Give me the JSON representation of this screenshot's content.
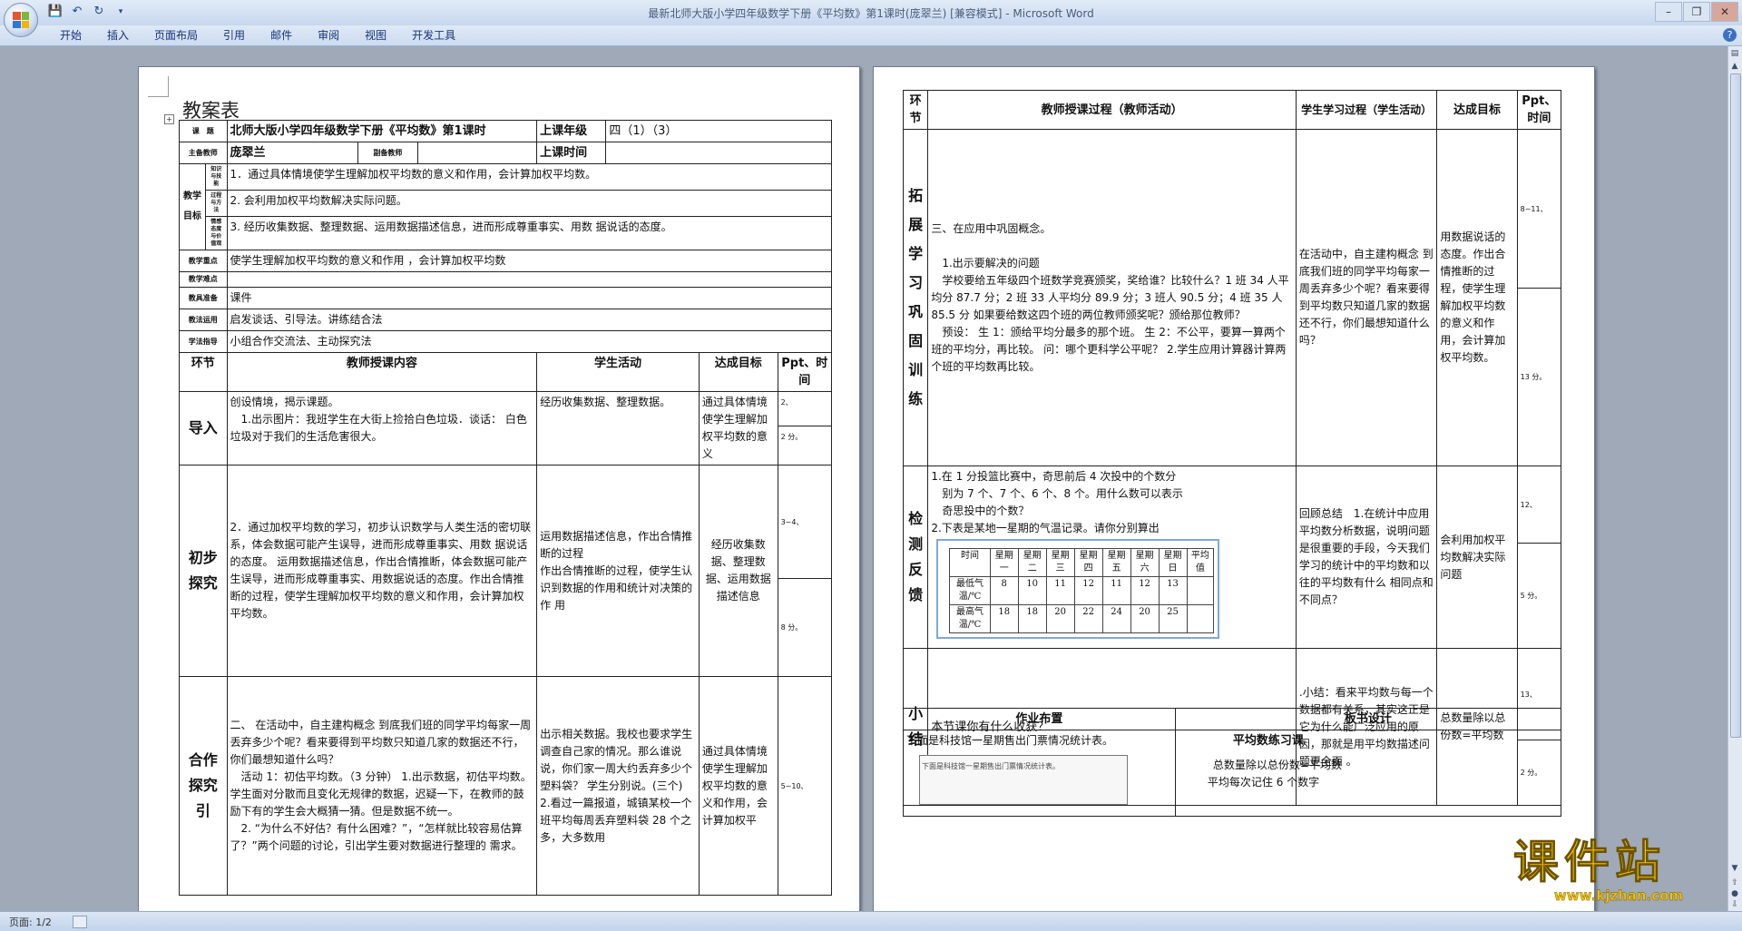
{
  "window": {
    "title": "最新北师大版小学四年级数学下册《平均数》第1课时(庞翠兰) [兼容模式] - Microsoft Word"
  },
  "ribbon": {
    "tabs": [
      "开始",
      "插入",
      "页面布局",
      "引用",
      "邮件",
      "审阅",
      "视图",
      "开发工具"
    ]
  },
  "page1": {
    "title": "教案表",
    "info": {
      "lesson_label": "课　题",
      "lesson": "北师大版小学四年级数学下册《平均数》第1课时",
      "grade_label": "上课年级",
      "grade": "四（1）（3）",
      "main_teacher_label": "主备教师",
      "main_teacher": "庞翠兰",
      "vice_teacher_label": "副备教师",
      "time_label": "上课时间"
    },
    "goals_label": "教学目标",
    "goal_sub_labels": [
      "知识与技能",
      "过程与方法",
      "情感态度与价值观"
    ],
    "goals": [
      "1．通过具体情境使学生理解加权平均数的意义和作用，会计算加权平均数。",
      "2. 会利用加权平均数解决实际问题。",
      "3. 经历收集数据、整理数据、运用数据描述信息，进而形成尊重事实、用数 据说话的态度。"
    ],
    "rows": [
      {
        "label": "教学重点",
        "text": "使学生理解加权平均数的意义和作用 ，会计算加权平均数"
      },
      {
        "label": "教学难点",
        "text": ""
      },
      {
        "label": "教具准备",
        "text": "课件"
      },
      {
        "label": "教法运用",
        "text": "启发谈话、引导法。讲练结合法"
      },
      {
        "label": "学法指导",
        "text": "小组合作交流法、主动探究法"
      }
    ],
    "header": {
      "section": "环节",
      "teacher": "教师授课内容",
      "student": "学生活动",
      "goal": "达成目标",
      "time": "Ppt、时间"
    },
    "stages": [
      {
        "name": "导入",
        "teacher": "创设情境，揭示课题。\n　1.出示图片：我班学生在大街上捡拾白色垃圾．谈话： 白色垃圾对于我们的生活危害很大。",
        "student": "经历收集数据、整理数据。",
        "goal": "通过具体情境使学生理解加权平均数的意义",
        "ppt": "2、",
        "time": "2 分。"
      },
      {
        "name": "初步探究",
        "teacher": "2．通过加权平均数的学习，初步认识数学与人类生活的密切联系，体会数据可能产生误导，进而形成尊重事实、用数 据说话的态度。 运用数据描述信息，作出合情推断，体会数据可能产生误导，进而形成尊重事实、用数据说话的态度。作出合情推断的过程，使学生理解加权平均数的意义和作用，会计算加权平均数。",
        "student": "运用数据描述信息，作出合情推断的过程\n作出合情推断的过程，使学生认识到数据的作用和统计对决策的作 用",
        "goal": "经历收集数据、整理数据、运用数据描述信息",
        "ppt": "3~4、",
        "time": "8 分。"
      },
      {
        "name": "合作探究引",
        "teacher": "二、 在活动中，自主建构概念 到底我们班的同学平均每家一周丢弃多少个呢？看来要得到平均数只知道几家的数据还不行，你们最想知道什么吗？\n　活动 1：初估平均数。（3 分钟） 1.出示数据，初估平均数。学生面对分散而且变化无规律的数据，迟疑一下，在教师的鼓励下有的学生会大概猜一猜。但是数据不统一。\n　2. “为什么不好估？有什么困难？”，“怎样就比较容易估算了？”两个问题的讨论，引出学生要对数据进行整理的 需求。",
        "student": "出示相关数据。我校也要求学生调查自己家的情况。那么谁说说，你们家一周大约丢弃多少个塑料袋？ 学生分别说。(三个)\n2.看过一篇报道，城镇某校一个班平均每周丢弃塑料袋 28 个之多，大多数用",
        "goal": "通过具体情境使学生理解加权平均数的意义和作用，会计算加权平",
        "ppt": "5~10、",
        "time": ""
      }
    ]
  },
  "page2": {
    "header": {
      "section": "环节",
      "teacher": "教师授课过程（教师活动）",
      "student": "学生学习过程（学生活动）",
      "goal": "达成目标",
      "time": "Ppt、时间"
    },
    "stages": [
      {
        "name": "拓展学习巩固训练",
        "teacher": "三、在应用中巩固概念。\n\n　1.出示要解决的问题\n　学校要给五年级四个班数学竞赛颁奖，奖给谁？比较什么？1 班 34 人平均分 87.7 分；2 班 33 人平均分 89.9 分；3 班人 90.5 分；4 班 35 人 85.5 分 如果要给数这四个班的两位教师颁奖呢？颁给那位教师？\n　预设： 生 1：颁给平均分最多的那个班。 生 2：不公平，要算一算两个班的平均分，再比较。 问：哪个更科学公平呢？ 2.学生应用计算器计算两个班的平均数再比较。",
        "student": "在活动中，自主建构概念 到底我们班的同学平均每家一周丢弃多少个呢？看来要得到平均数只知道几家的数据还不行，你们最想知道什么吗？",
        "goal": "用数据说话的态度。作出合情推断的过程，使学生理解加权平均数的意义和作用，会计算加权平均数。",
        "ppt": "8~11、",
        "time": "13 分。"
      },
      {
        "name": "检测反馈",
        "teacher_lines": [
          "1.在 1 分投篮比赛中，奇思前后 4 次投中的个数分",
          "　别为 7 个、7 个、6 个、8 个。用什么数可以表示",
          "　奇思投中的个数？",
          "2.下表是某地一星期的气温记录。请你分别算出"
        ],
        "temp_table": {
          "headers": [
            "时间",
            "星期一",
            "星期二",
            "星期三",
            "星期四",
            "星期五",
            "星期六",
            "星期日",
            "平均值"
          ],
          "rows": [
            {
              "label": "最低气温/℃",
              "values": [
                "8",
                "10",
                "11",
                "12",
                "11",
                "12",
                "13",
                ""
              ]
            },
            {
              "label": "最高气温/℃",
              "values": [
                "18",
                "18",
                "20",
                "22",
                "24",
                "20",
                "25",
                ""
              ]
            }
          ]
        },
        "student": "回顾总结　1.在统计中应用平均数分析数据，说明问题是很重要的手段，今天我们学习的统计中的平均数和以往的平均数有什么 相同点和不同点？",
        "goal": "会利用加权平均数解决实际问题",
        "ppt": "12、",
        "time": "5 分。"
      },
      {
        "name": "小结",
        "teacher": "本节课你有什么收获？",
        "student": ".小结：看来平均数与每一个数据都有关系，其实这正是它为什么能广泛应用的原因，那就是用平均数描述问题更全面 。",
        "goal": "总数量除以总份数=平均数",
        "ppt": "13、",
        "time": "2 分。"
      }
    ],
    "homework_label": "作业布置",
    "board_label": "板书设计",
    "homework_text": "下面是科技馆一星期售出门票情况统计表。",
    "homework_image_caption": "下面是科技馆一星期售出门票情况统计表。",
    "board_title": "平均数练习课",
    "board_lines": [
      "总数量除以总份数=平均数",
      "平均每次记住 6 个数字"
    ]
  },
  "statusbar": {
    "page": "页面: 1/2"
  },
  "watermark": {
    "text": "课件站",
    "url": "www.kjzhan.com"
  },
  "colors": {
    "workspace": "#9fa9b8",
    "ribbon": "#cddcf0",
    "watermark": "#f2c200"
  }
}
